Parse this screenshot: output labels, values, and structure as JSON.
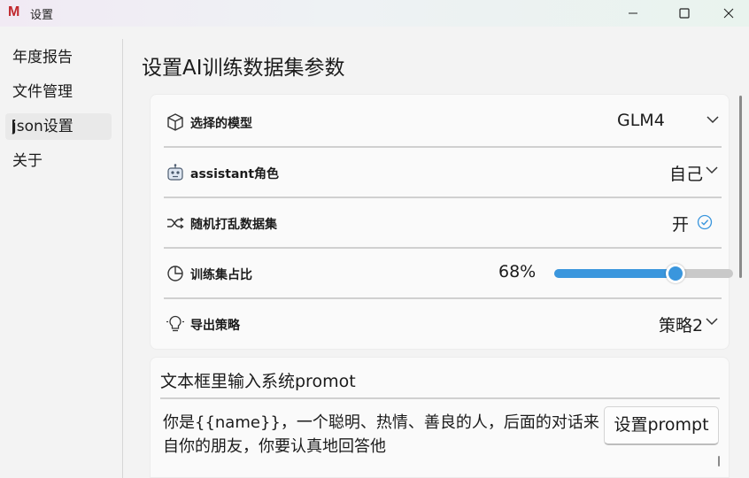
{
  "window": {
    "title": "设置",
    "logo_letter": "M",
    "logo_color": "#c0272d"
  },
  "sidebar": {
    "items": [
      {
        "label": "年度报告",
        "selected": false
      },
      {
        "label": "文件管理",
        "selected": false
      },
      {
        "label": "json设置",
        "selected": true
      },
      {
        "label": "关于",
        "selected": false
      }
    ]
  },
  "main": {
    "page_title": "设置AI训练数据集参数",
    "settings": {
      "model": {
        "label": "选择的模型",
        "value": "GLM4",
        "icon": "cube-icon"
      },
      "assistant_role": {
        "label": "assistant角色",
        "value": "自己",
        "icon": "robot-icon"
      },
      "shuffle": {
        "label": "随机打乱数据集",
        "value": "开",
        "icon": "shuffle-icon",
        "checked": true
      },
      "train_ratio": {
        "label": "训练集占比",
        "value_text": "68%",
        "value": 0.68,
        "icon": "pie-chart-icon"
      },
      "export_strategy": {
        "label": "导出策略",
        "value": "策略2",
        "icon": "lightbulb-icon"
      }
    },
    "prompt": {
      "title": "文本框里输入系统promot",
      "text": "你是{{name}}，一个聪明、热情、善良的人，后面的对话来自你的朋友，你要认真地回答他",
      "button_label": "设置prompt"
    }
  },
  "colors": {
    "accent": "#3a96dd",
    "check": "#3a96dd"
  }
}
